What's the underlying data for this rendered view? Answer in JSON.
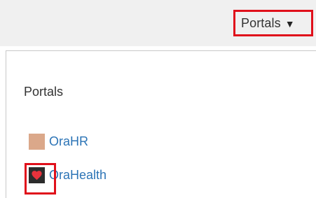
{
  "header": {
    "portals_menu_label": "Portals",
    "caret_glyph": "▼"
  },
  "panel": {
    "heading": "Portals",
    "items": [
      {
        "label": "OraHR",
        "icon": "tan-square-icon",
        "icon_color": "#dba88a"
      },
      {
        "label": "OraHealth",
        "icon": "heart-icon",
        "icon_color": "#2c2c2c"
      }
    ]
  },
  "colors": {
    "highlight": "#e0101b",
    "link": "#2c74b6",
    "top_bar": "#f0f0f0"
  }
}
